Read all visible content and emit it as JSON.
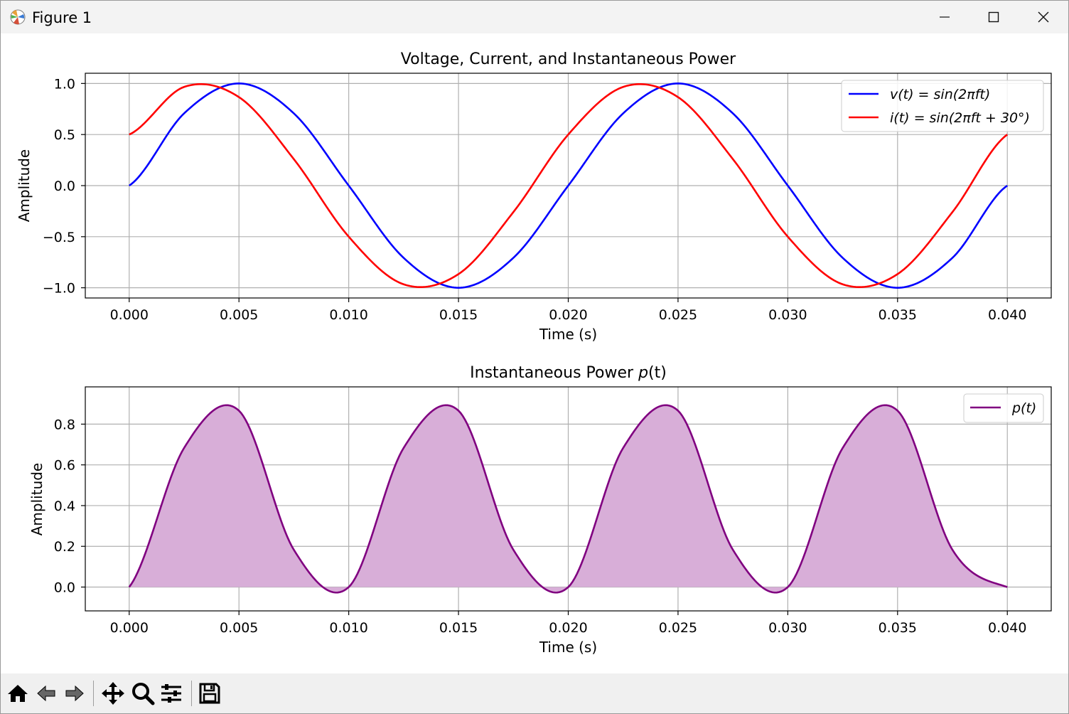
{
  "window": {
    "title": "Figure 1",
    "controls": {
      "minimize_icon": "minimize-icon",
      "maximize_icon": "maximize-icon",
      "close_icon": "close-icon"
    }
  },
  "toolbar": {
    "buttons": [
      "home-icon",
      "back-icon",
      "forward-icon",
      "pan-icon",
      "zoom-icon",
      "configure-subplots-icon",
      "save-icon"
    ]
  },
  "colors": {
    "voltage": "#0000ff",
    "current": "#ff0000",
    "power": "#800080",
    "power_fill": "#d8aed8",
    "grid": "#b0b0b0"
  },
  "chart_data": [
    {
      "type": "line",
      "title": "Voltage, Current, and Instantaneous Power",
      "xlabel": "Time (s)",
      "ylabel": "Amplitude",
      "xlim": [
        -0.002,
        0.042
      ],
      "ylim": [
        -1.1,
        1.1
      ],
      "x_ticks": [
        0.0,
        0.005,
        0.01,
        0.015,
        0.02,
        0.025,
        0.03,
        0.035,
        0.04
      ],
      "x_tick_labels": [
        "0.000",
        "0.005",
        "0.010",
        "0.015",
        "0.020",
        "0.025",
        "0.030",
        "0.035",
        "0.040"
      ],
      "y_ticks": [
        -1.0,
        -0.5,
        0.0,
        0.5,
        1.0
      ],
      "y_tick_labels": [
        "−1.0",
        "−0.5",
        "0.0",
        "0.5",
        "1.0"
      ],
      "grid": true,
      "legend_position": "upper right",
      "x": [
        0.0,
        0.0025,
        0.005,
        0.0075,
        0.01,
        0.0125,
        0.015,
        0.0175,
        0.02,
        0.0225,
        0.025,
        0.0275,
        0.03,
        0.0325,
        0.035,
        0.0375,
        0.04
      ],
      "series": [
        {
          "name_prefix": "v(t) = sin(2",
          "name_pi": "π",
          "name_suffix": "ft)",
          "color": "#0000ff",
          "values": [
            0.0,
            0.707,
            1.0,
            0.707,
            0.0,
            -0.707,
            -1.0,
            -0.707,
            0.0,
            0.707,
            1.0,
            0.707,
            0.0,
            -0.707,
            -1.0,
            -0.707,
            0.0
          ]
        },
        {
          "name_prefix": "i(t) = sin(2",
          "name_pi": "π",
          "name_suffix": "ft + 30°)",
          "color": "#ff0000",
          "values": [
            0.5,
            0.966,
            0.866,
            0.259,
            -0.5,
            -0.966,
            -0.866,
            -0.259,
            0.5,
            0.966,
            0.866,
            0.259,
            -0.5,
            -0.966,
            -0.866,
            -0.259,
            0.5
          ]
        }
      ]
    },
    {
      "type": "area",
      "title_prefix": "Instantaneous Power ",
      "title_italic": "p",
      "title_suffix": "(t)",
      "xlabel": "Time (s)",
      "ylabel": "Amplitude",
      "xlim": [
        -0.002,
        0.042
      ],
      "ylim": [
        -0.117,
        0.983
      ],
      "x_ticks": [
        0.0,
        0.005,
        0.01,
        0.015,
        0.02,
        0.025,
        0.03,
        0.035,
        0.04
      ],
      "x_tick_labels": [
        "0.000",
        "0.005",
        "0.010",
        "0.015",
        "0.020",
        "0.025",
        "0.030",
        "0.035",
        "0.040"
      ],
      "y_ticks": [
        0.0,
        0.2,
        0.4,
        0.6,
        0.8
      ],
      "y_tick_labels": [
        "0.0",
        "0.2",
        "0.4",
        "0.6",
        "0.8"
      ],
      "grid": true,
      "legend_position": "upper right",
      "x": [
        0.0,
        0.0025,
        0.005,
        0.0075,
        0.01,
        0.0125,
        0.015,
        0.0175,
        0.02,
        0.0225,
        0.025,
        0.0275,
        0.03,
        0.0325,
        0.035,
        0.0375,
        0.04
      ],
      "series": [
        {
          "name": "p(t)",
          "color": "#800080",
          "fill": "#d8aed8",
          "values": [
            0.0,
            0.683,
            0.866,
            0.183,
            0.0,
            0.683,
            0.866,
            0.183,
            0.0,
            0.683,
            0.866,
            0.183,
            0.0,
            0.683,
            0.866,
            0.183,
            0.0
          ]
        }
      ]
    }
  ]
}
